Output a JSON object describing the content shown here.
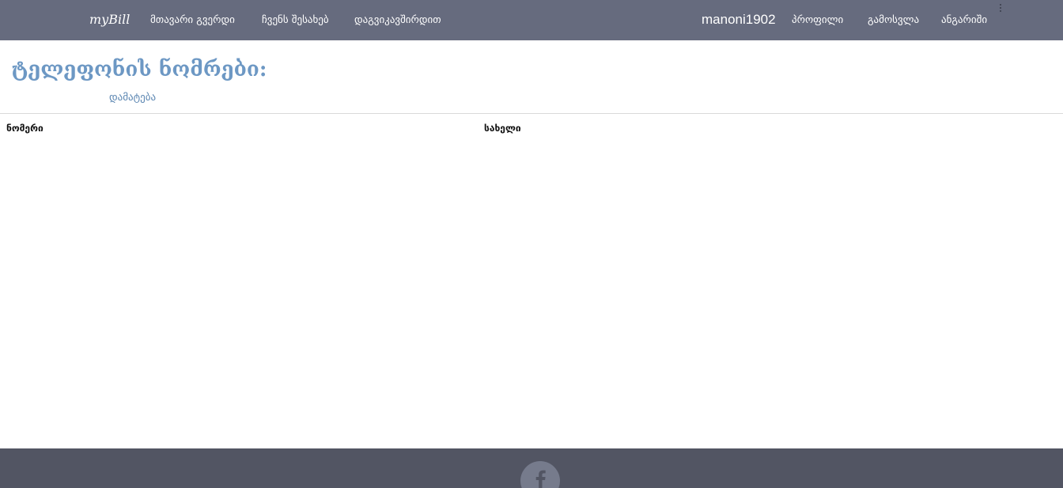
{
  "navbar": {
    "brand": "myBill",
    "links": [
      {
        "label": "მთავარი გვერდი"
      },
      {
        "label": "ჩვენს შესახებ"
      },
      {
        "label": "დაგვიკავშირდით"
      }
    ],
    "username": "manoni1902",
    "user_links": [
      {
        "label": "პროფილი"
      },
      {
        "label": "გამოსვლა"
      },
      {
        "label": "ანგარიში"
      }
    ],
    "colors": {
      "background": "#666b7e",
      "text": "#ffffff"
    }
  },
  "main": {
    "title": "ტელეფონის ნომრები:",
    "add_label": "დამატება",
    "table": {
      "headers": [
        "ნომერი",
        "სახელი"
      ],
      "rows": []
    },
    "colors": {
      "title": "#6d98c4",
      "link": "#5a85b1"
    }
  },
  "footer": {
    "social_icons": [
      "facebook-icon"
    ],
    "colors": {
      "background": "#525563",
      "icon_circle": "#767b8c"
    }
  }
}
